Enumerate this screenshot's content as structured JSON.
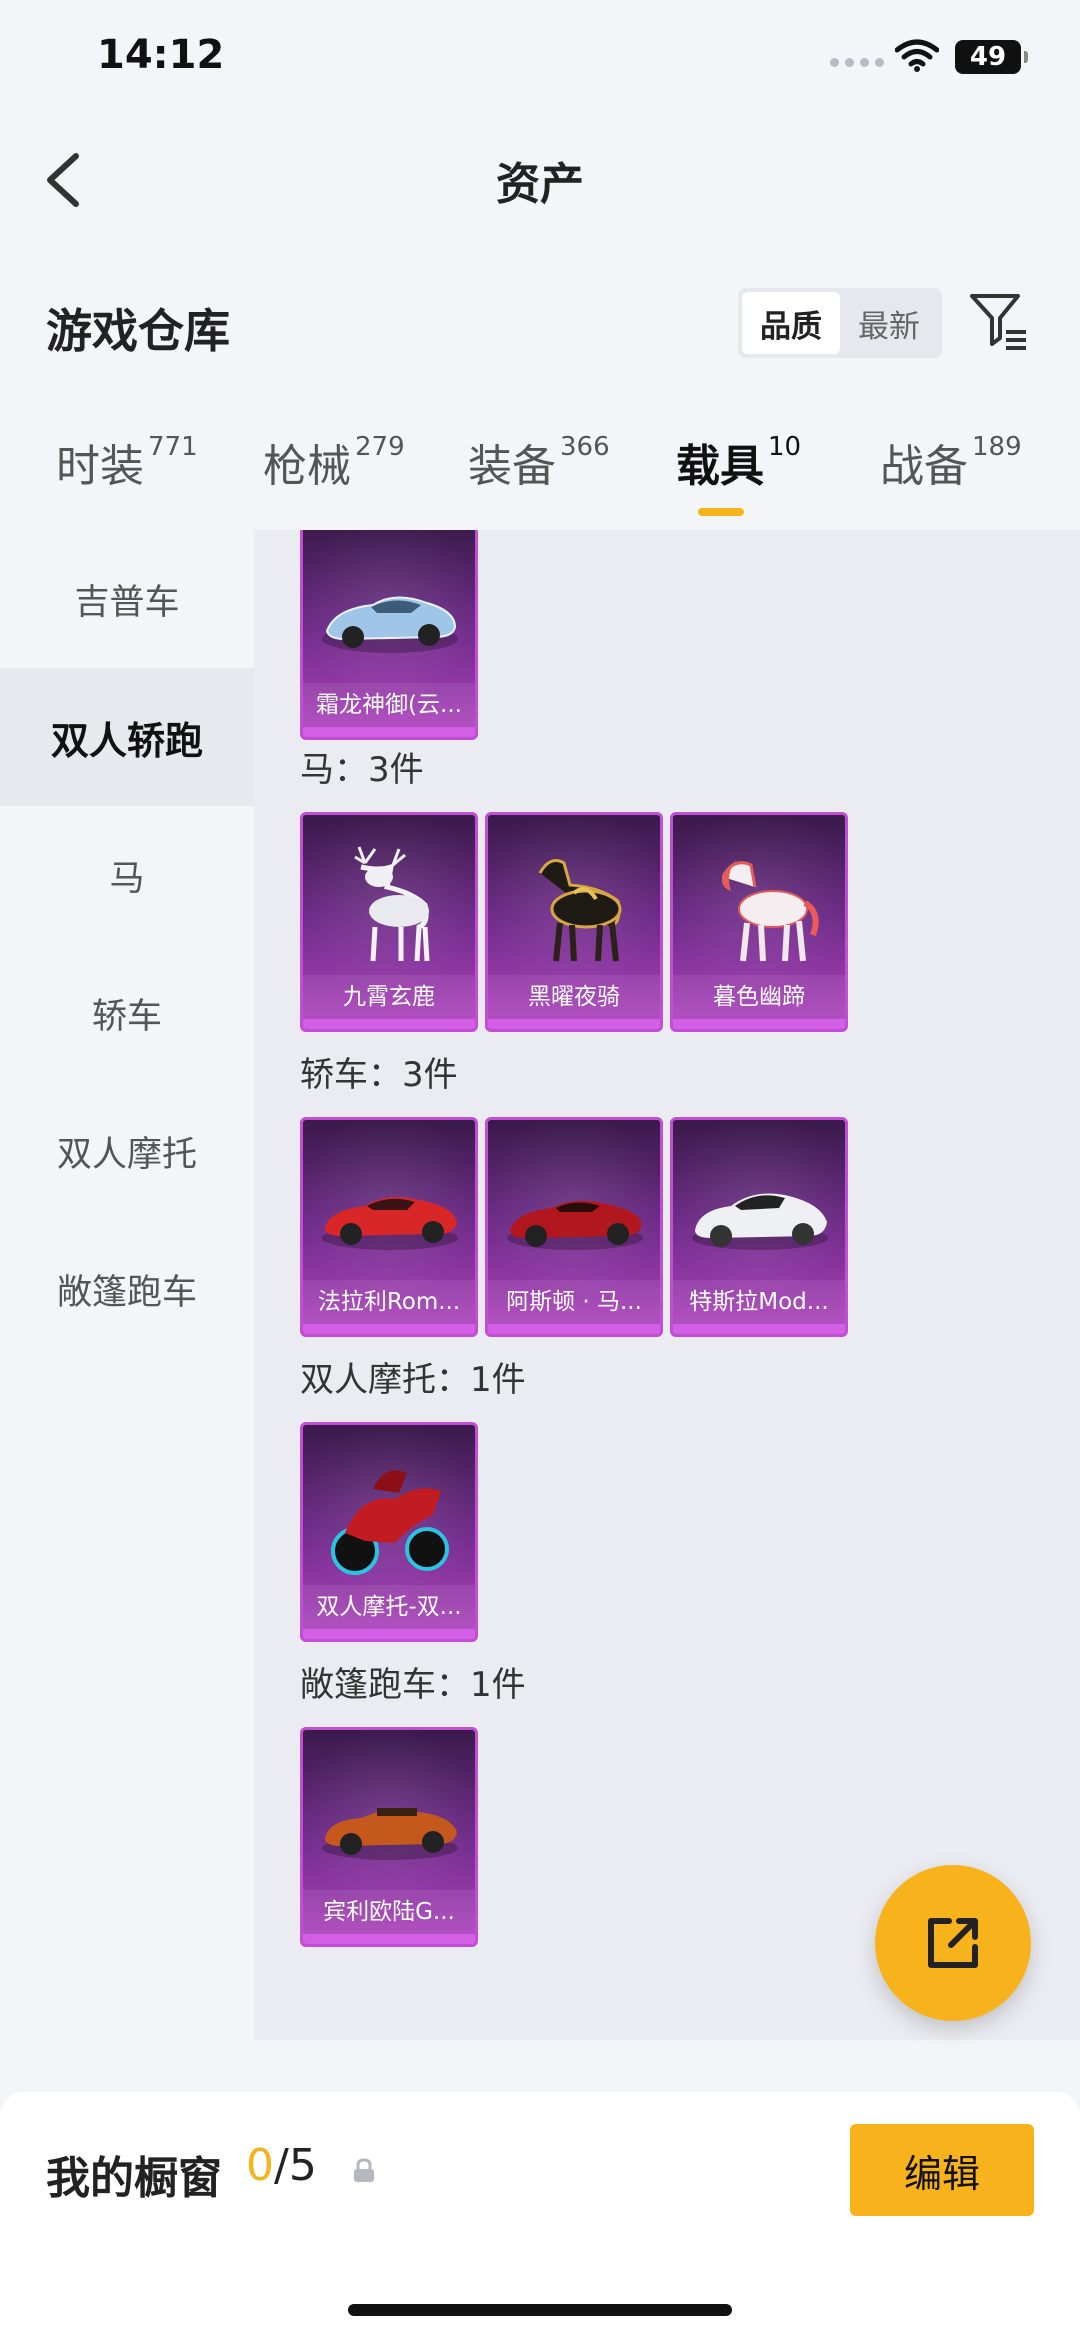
{
  "status": {
    "time": "14:12",
    "battery": "49"
  },
  "header": {
    "title": "资产"
  },
  "section": {
    "title": "游戏仓库"
  },
  "sort": {
    "options": [
      "品质",
      "最新"
    ]
  },
  "tabs": [
    {
      "label": "时装",
      "count": "771"
    },
    {
      "label": "枪械",
      "count": "279"
    },
    {
      "label": "装备",
      "count": "366"
    },
    {
      "label": "载具",
      "count": "10"
    },
    {
      "label": "战备",
      "count": "189"
    }
  ],
  "sidebar": {
    "items": [
      "吉普车",
      "双人轿跑",
      "马",
      "轿车",
      "双人摩托",
      "敞篷跑车"
    ]
  },
  "groups": [
    {
      "title": "",
      "items": [
        "霜龙神御(云..."
      ]
    },
    {
      "title": "马：3件",
      "items": [
        "九霄玄鹿",
        "黑曜夜骑",
        "暮色幽蹄"
      ]
    },
    {
      "title": "轿车：3件",
      "items": [
        "法拉利Rom...",
        "阿斯顿 · 马...",
        "特斯拉Mod..."
      ]
    },
    {
      "title": "双人摩托：1件",
      "items": [
        "双人摩托-双..."
      ]
    },
    {
      "title": "敞篷跑车：1件",
      "items": [
        "宾利欧陆G..."
      ]
    }
  ],
  "bottom": {
    "label": "我的橱窗",
    "current": "0",
    "total": "/5",
    "edit_label": "编辑"
  },
  "colors": {
    "accent": "#f8b31c",
    "card_purple": "#b043c0"
  }
}
